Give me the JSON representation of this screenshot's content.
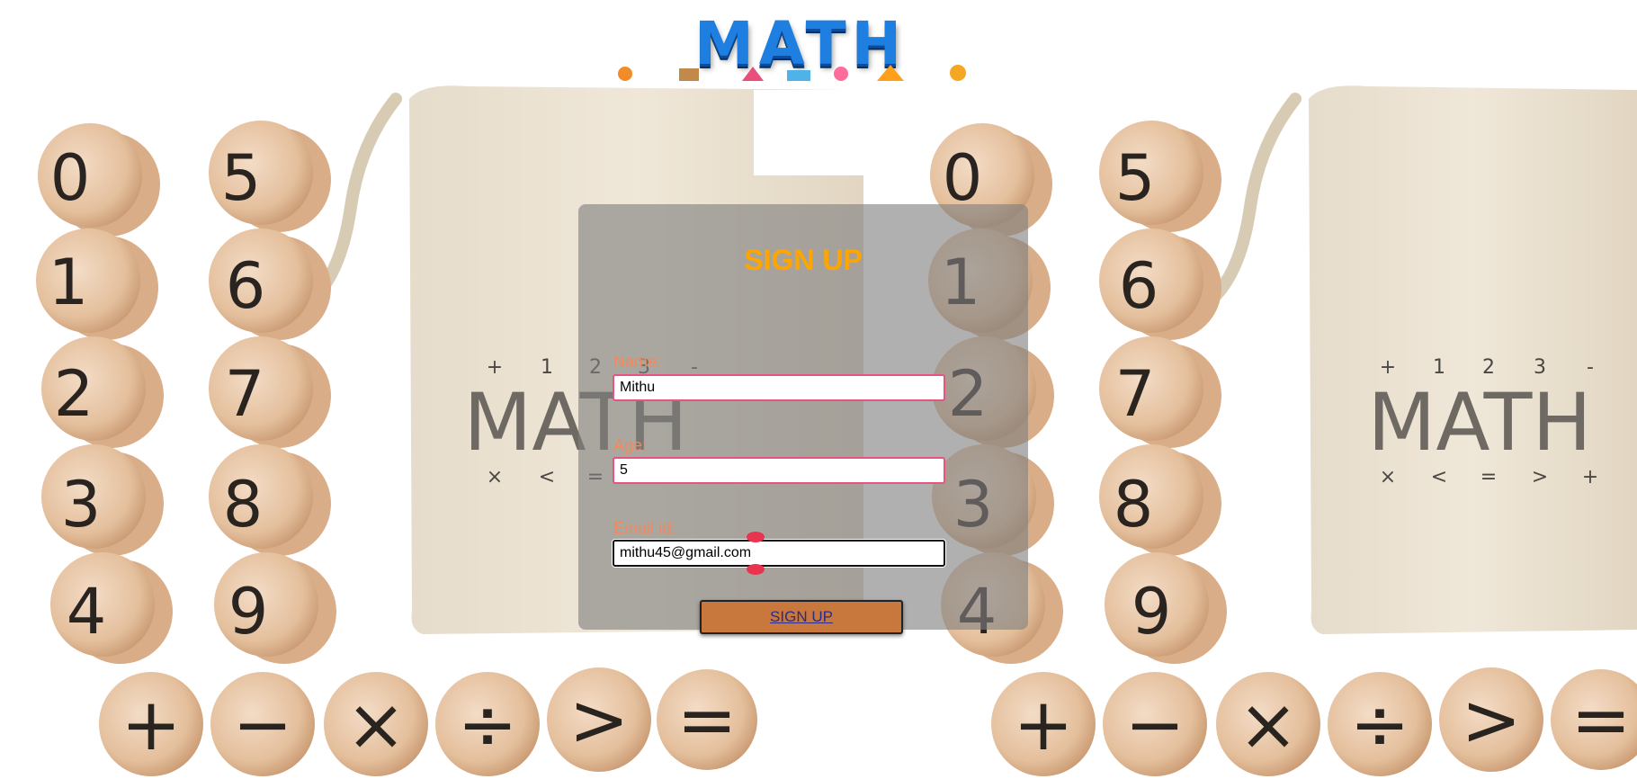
{
  "logo": {
    "text": "MATH"
  },
  "background": {
    "bag_labels": [
      "MATH",
      "MATH"
    ],
    "bag_symbols_top": [
      "+",
      "1",
      "2",
      "3",
      "-"
    ],
    "bag_symbols_bottom": [
      "×",
      "<",
      "=",
      ">",
      "+"
    ],
    "digit_tokens_left": [
      "0",
      "1",
      "2",
      "3",
      "4",
      "5",
      "6",
      "7",
      "8",
      "9"
    ],
    "digit_tokens_right": [
      "0",
      "1",
      "2",
      "3",
      "4",
      "5",
      "6",
      "7",
      "8",
      "9"
    ],
    "operator_tokens": [
      "+",
      "−",
      "×",
      "÷",
      ">",
      "="
    ]
  },
  "form": {
    "title": "SIGN UP",
    "fields": [
      {
        "label": "Name:",
        "value": "Mithu"
      },
      {
        "label": "Age:",
        "value": "5"
      },
      {
        "label": "Email id:",
        "value": "mithu45@gmail.com"
      }
    ],
    "submit_label": "SIGN UP"
  },
  "colors": {
    "title": "#ffa500",
    "label": "#f08a5d",
    "input_border": "#e75480",
    "button_bg": "#c8773d",
    "panel": "rgba(128,128,128,0.62)"
  }
}
